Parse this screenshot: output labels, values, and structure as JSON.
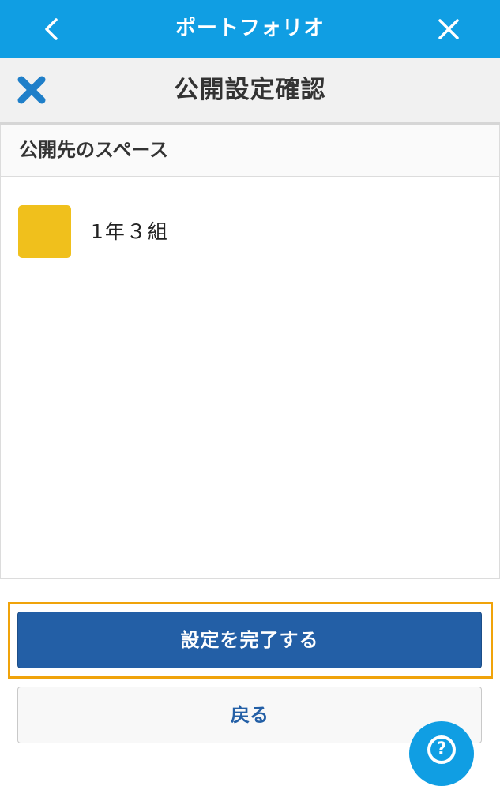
{
  "app": {
    "title": "ポートフォリオ"
  },
  "dialog": {
    "title": "公開設定確認"
  },
  "section": {
    "label": "公開先のスペース"
  },
  "spaces": [
    {
      "name": "1年３組",
      "color": "#f0c01c"
    }
  ],
  "buttons": {
    "confirm": "設定を完了する",
    "back": "戻る"
  },
  "help": {
    "symbol": "?"
  },
  "icons": {
    "back": "chevron-left-icon",
    "close": "close-icon",
    "dialog_close": "x-icon",
    "help": "help-icon"
  },
  "colors": {
    "header": "#109ee3",
    "primary": "#235fa6",
    "highlight": "#f0a30a",
    "accent_x": "#1f7fc9"
  }
}
